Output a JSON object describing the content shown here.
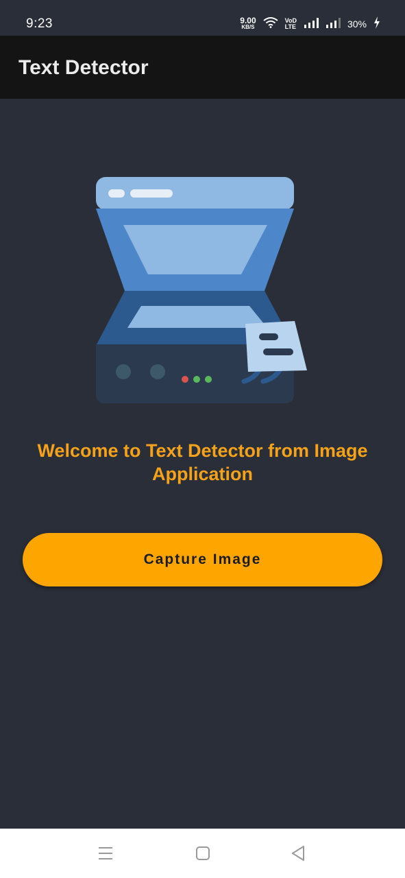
{
  "status_bar": {
    "time": "9:23",
    "net_speed_value": "9.00",
    "net_speed_unit": "KB/S",
    "volte_top": "VoD",
    "volte_bottom": "LTE",
    "battery": "30%"
  },
  "app_bar": {
    "title": "Text Detector"
  },
  "main": {
    "welcome_text": "Welcome to Text Detector from Image Application",
    "capture_button_label": "Capture Image"
  },
  "colors": {
    "background": "#2a2e38",
    "app_bar": "#141414",
    "accent": "#ffa500",
    "welcome_text": "#f4a21a"
  },
  "icons": {
    "illustration": "document-scanner-icon",
    "wifi": "wifi-icon",
    "signal": "signal-icon",
    "battery": "charging-icon",
    "nav_recent": "menu-icon",
    "nav_home": "square-home-icon",
    "nav_back": "triangle-back-icon"
  }
}
